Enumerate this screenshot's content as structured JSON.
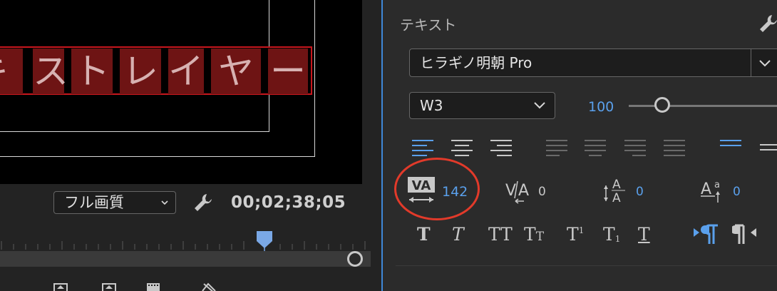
{
  "monitor": {
    "title_glyphs": [
      "キ",
      "ス",
      "ト",
      "レ",
      "イ",
      "ヤ",
      "ー"
    ],
    "quality_label": "フル画質",
    "timecode": "00;02;38;05"
  },
  "text_panel": {
    "section_title": "テキスト",
    "font_family": "ヒラギノ明朝 Pro",
    "font_style": "W3",
    "font_size": "100",
    "tracking": "142",
    "kerning": "0",
    "leading": "0",
    "baseline_shift": "0",
    "colors": {
      "accent": "#5aa0ec",
      "highlight_ring": "#e23a2a",
      "title_box_border": "#c8161d"
    }
  }
}
